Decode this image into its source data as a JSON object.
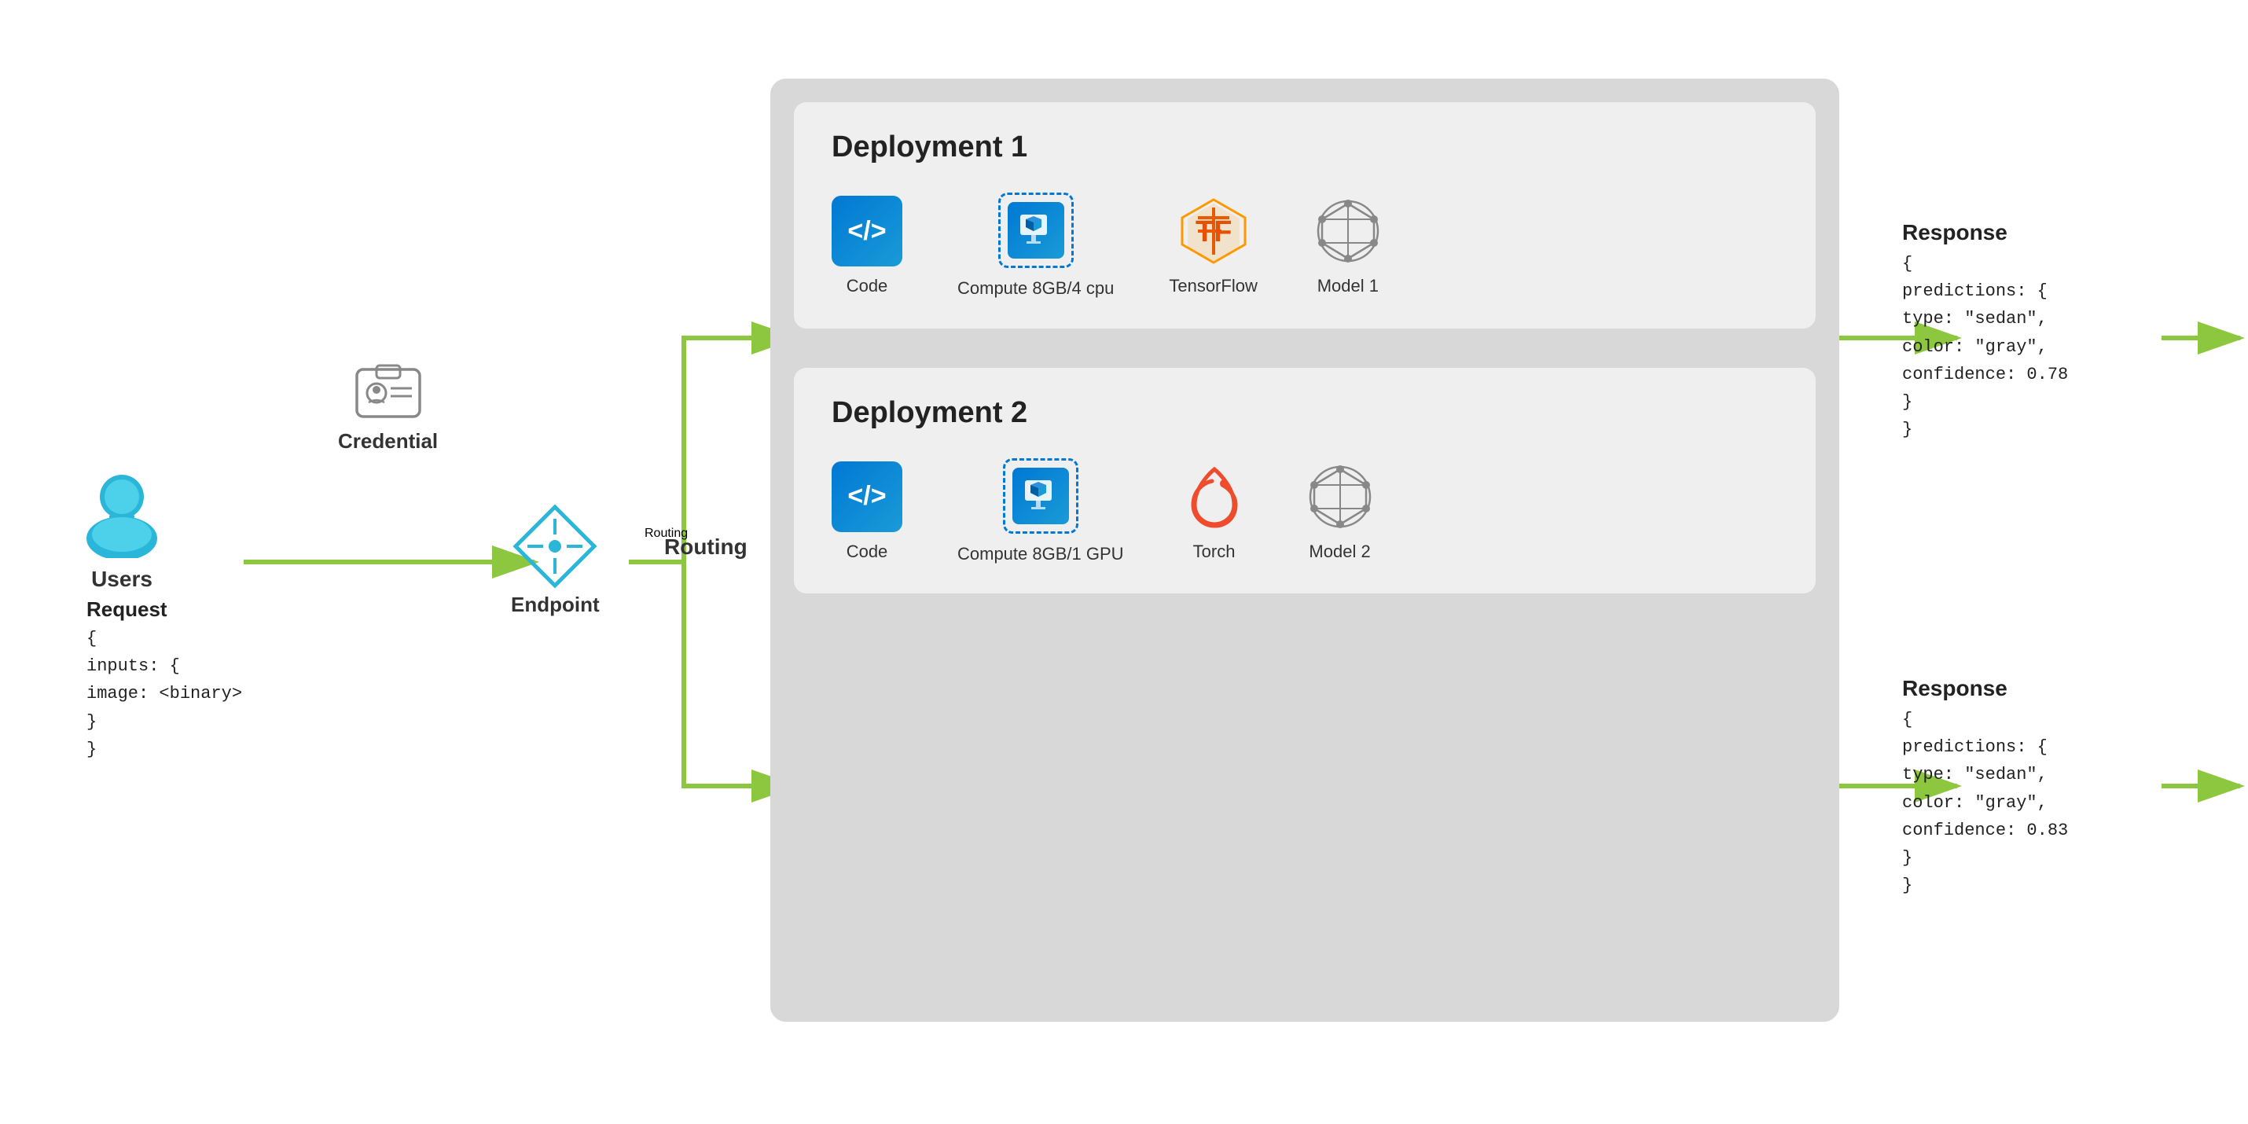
{
  "user": {
    "label": "Users",
    "icon_color": "#29b6d8"
  },
  "credential": {
    "label": "Credential"
  },
  "endpoint": {
    "label": "Endpoint"
  },
  "routing": {
    "label": "Routing"
  },
  "request": {
    "title": "Request",
    "line1": "{",
    "line2": "    inputs: {",
    "line3": "        image: <binary>",
    "line4": "    }",
    "line5": "}"
  },
  "deployment1": {
    "title": "Deployment 1",
    "code_label": "Code",
    "compute_label": "Compute\n8GB/4 cpu",
    "framework_label": "TensorFlow",
    "model_label": "Model 1"
  },
  "deployment2": {
    "title": "Deployment 2",
    "code_label": "Code",
    "compute_label": "Compute\n8GB/1 GPU",
    "framework_label": "Torch",
    "model_label": "Model 2"
  },
  "response1": {
    "title": "Response",
    "line1": "{",
    "line2": "    predictions: {",
    "line3": "        type: \"sedan\",",
    "line4": "        color: \"gray\",",
    "line5": "        confidence: 0.78",
    "line6": "    }",
    "line7": "}"
  },
  "response2": {
    "title": "Response",
    "line1": "{",
    "line2": "    predictions: {",
    "line3": "        type: \"sedan\",",
    "line4": "        color: \"gray\",",
    "line5": "        confidence: 0.83",
    "line6": "    }",
    "line7": "}"
  },
  "arrows": {
    "color": "#8dc63f"
  }
}
